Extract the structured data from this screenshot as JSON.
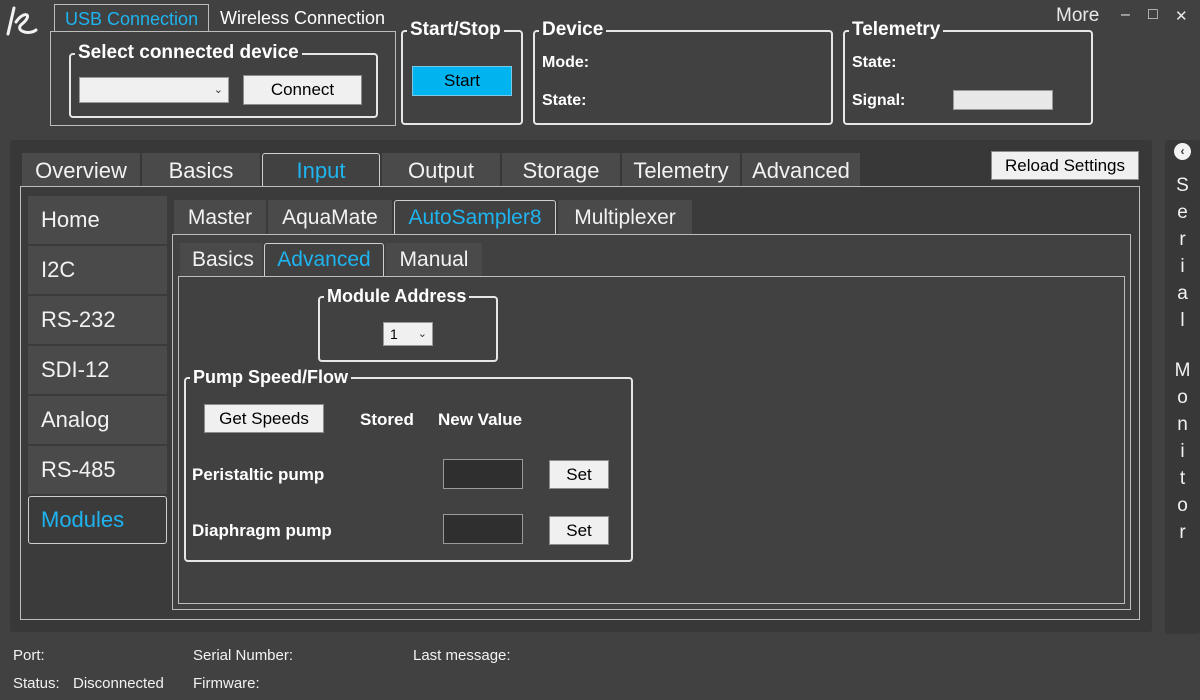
{
  "connection_tabs": [
    "USB Connection",
    "Wireless Connection"
  ],
  "window": {
    "more_label": "More",
    "minimize": "–",
    "maximize": "□",
    "close": "✕"
  },
  "device_select": {
    "group_label": "Select connected device",
    "selected": "",
    "connect_label": "Connect"
  },
  "start_stop": {
    "group_label": "Start/Stop",
    "start_label": "Start"
  },
  "device": {
    "group_label": "Device",
    "mode_label": "Mode:",
    "state_label": "State:"
  },
  "telemetry": {
    "group_label": "Telemetry",
    "state_label": "State:",
    "signal_label": "Signal:"
  },
  "main_tabs": [
    "Overview",
    "Basics",
    "Input",
    "Output",
    "Storage",
    "Telemetry",
    "Advanced"
  ],
  "reload_label": "Reload Settings",
  "sidenav": [
    "Home",
    "I2C",
    "RS-232",
    "SDI-12",
    "Analog",
    "RS-485",
    "Modules"
  ],
  "module_tabs": [
    "Master",
    "AquaMate",
    "AutoSampler8",
    "Multiplexer"
  ],
  "sub_tabs": [
    "Basics",
    "Advanced",
    "Manual"
  ],
  "module_address": {
    "group_label": "Module Address",
    "selected": "1"
  },
  "pump": {
    "group_label": "Pump Speed/Flow",
    "get_speeds_label": "Get Speeds",
    "stored_header": "Stored",
    "new_value_header": "New Value",
    "rows": [
      {
        "label": "Peristaltic pump",
        "stored": "",
        "new_value": "",
        "set_label": "Set"
      },
      {
        "label": "Diaphragm pump",
        "stored": "",
        "new_value": "",
        "set_label": "Set"
      }
    ]
  },
  "serial_monitor": {
    "letters": [
      "S",
      "e",
      "r",
      "i",
      "a",
      "l",
      "M",
      "o",
      "n",
      "i",
      "t",
      "o",
      "r"
    ]
  },
  "status_bar": {
    "port_label": "Port:",
    "status_label": "Status:",
    "status_value": "Disconnected",
    "serial_label": "Serial Number:",
    "firmware_label": "Firmware:",
    "last_message_label": "Last message:"
  },
  "colors": {
    "accent": "#1eb4f0",
    "start_button": "#00b4f0",
    "background": "#414141"
  },
  "icons": {
    "logo": "app-logo-icon",
    "collapse": "chevron-left-icon",
    "dropdown": "chevron-down-icon"
  }
}
